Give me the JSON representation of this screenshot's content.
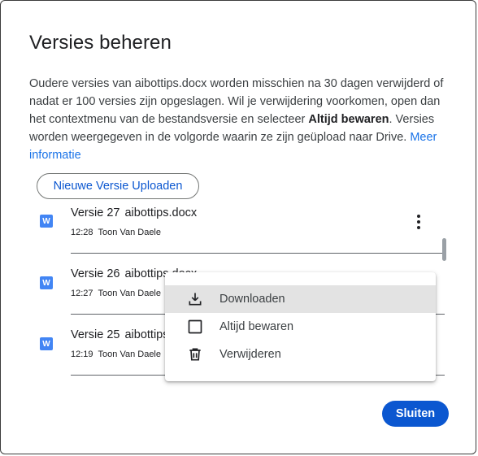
{
  "dialog": {
    "title": "Versies beheren",
    "description": {
      "part1": "Oudere versies van aibottips.docx worden misschien na 30 dagen verwijderd of nadat er 100 versies zijn opgeslagen. Wil je verwijdering voorkomen, open dan het contextmenu van de bestandsversie en selecteer ",
      "bold": "Altijd bewaren",
      "part2": ". Versies worden weergegeven in de volgorde waarin ze zijn geüpload naar Drive. ",
      "link": "Meer informatie"
    },
    "upload_button": "Nieuwe Versie Uploaden",
    "close_button": "Sluiten"
  },
  "versions": [
    {
      "icon": "word-doc-icon",
      "icon_letter": "W",
      "label": "Versie 27",
      "file": "aibottips.docx",
      "time": "12:28",
      "user": "Toon Van Daele"
    },
    {
      "icon": "word-doc-icon",
      "icon_letter": "W",
      "label": "Versie 26",
      "file": "aibottips.docx",
      "time": "12:27",
      "user": "Toon Van Daele"
    },
    {
      "icon": "word-doc-icon",
      "icon_letter": "W",
      "label": "Versie 25",
      "file": "aibottips.docx",
      "time": "12:19",
      "user": "Toon Van Daele"
    }
  ],
  "context_menu": {
    "items": [
      {
        "icon": "download-icon",
        "label": "Downloaden",
        "highlighted": true
      },
      {
        "icon": "checkbox-icon",
        "label": "Altijd bewaren"
      },
      {
        "icon": "trash-icon",
        "label": "Verwijderen"
      }
    ]
  },
  "colors": {
    "accent": "#0b57d0",
    "link": "#1a73e8",
    "word_icon": "#4285f4",
    "menu_highlight": "#e3e3e3"
  }
}
